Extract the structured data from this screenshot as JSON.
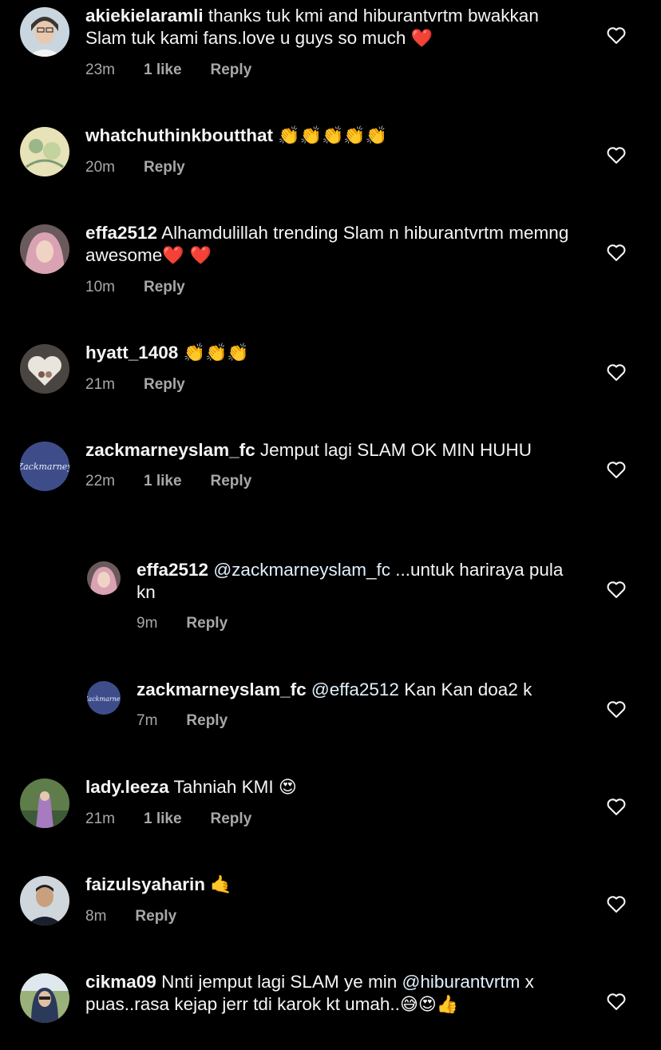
{
  "comments": [
    {
      "username": "akiekielaramli",
      "text": "thanks tuk kmi and hiburantvrtm bwakkan Slam tuk kami fans.love u guys so much",
      "emoji": "❤️",
      "time": "23m",
      "likes": "1 like",
      "reply": "Reply"
    },
    {
      "username": "whatchuthinkboutthat",
      "text": "",
      "emoji": "👏👏👏👏👏",
      "time": "20m",
      "likes": "",
      "reply": "Reply"
    },
    {
      "username": "effa2512",
      "text": "Alhamdulillah trending Slam n hiburantvrtm memng awesome",
      "emoji": "❤️ ❤️",
      "time": "10m",
      "likes": "",
      "reply": "Reply"
    },
    {
      "username": "hyatt_1408",
      "text": "",
      "emoji": "👏👏👏",
      "time": "21m",
      "likes": "",
      "reply": "Reply"
    },
    {
      "username": "zackmarneyslam_fc",
      "text": "Jemput lagi SLAM OK MIN HUHU",
      "emoji": "",
      "time": "22m",
      "likes": "1 like",
      "reply": "Reply"
    },
    {
      "username": "effa2512",
      "mention": "@zackmarneyslam_fc",
      "text": "...untuk hariraya pula kn",
      "emoji": "",
      "time": "9m",
      "likes": "",
      "reply": "Reply"
    },
    {
      "username": "zackmarneyslam_fc",
      "mention": "@effa2512",
      "text": "Kan Kan doa2 k",
      "emoji": "",
      "time": "7m",
      "likes": "",
      "reply": "Reply"
    },
    {
      "username": "lady.leeza",
      "text": "Tahniah KMI",
      "emoji": "😍",
      "time": "21m",
      "likes": "1 like",
      "reply": "Reply"
    },
    {
      "username": "faizulsyaharin",
      "text": "",
      "emoji": "🤙",
      "time": "8m",
      "likes": "",
      "reply": "Reply"
    },
    {
      "username": "cikma09",
      "text": "Nnti jemput lagi SLAM ye min",
      "mention2": "@hiburantvrtm",
      "text2": "x puas..rasa kejap jerr tdi karok kt umah..",
      "emoji": "😅😍👍",
      "time": "",
      "likes": "",
      "reply": ""
    }
  ],
  "colors": {
    "background": "#000000",
    "text": "#f5f5f5",
    "meta": "#a8a8a8",
    "mention": "#e0f1ff",
    "heart": "#f5f5f5"
  },
  "icons": {
    "like": "heart-outline-icon"
  }
}
